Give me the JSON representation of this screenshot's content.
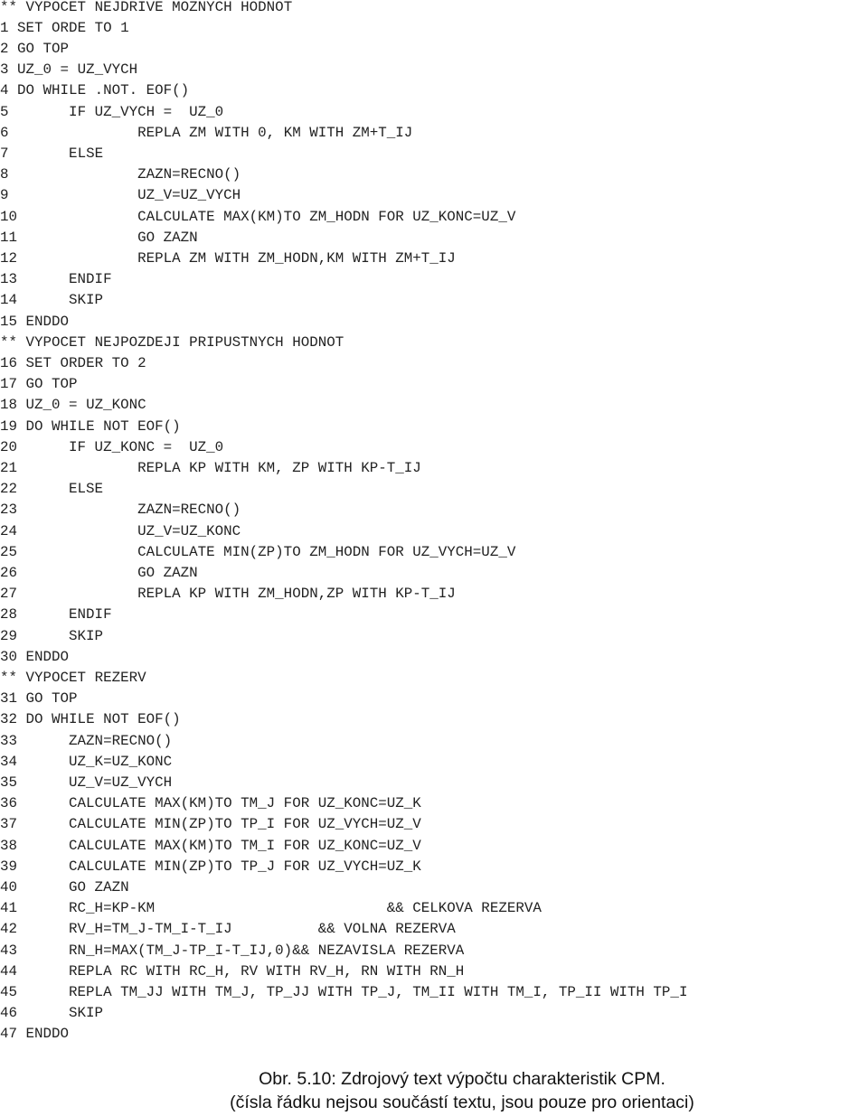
{
  "document": {
    "code_lines": [
      {
        "num": "**",
        "indent": 1,
        "text": "VYPOCET NEJDRIVE MOZNYCH HODNOT"
      },
      {
        "num": "1",
        "indent": 1,
        "text": "SET ORDE TO 1"
      },
      {
        "num": "2",
        "indent": 1,
        "text": "GO TOP"
      },
      {
        "num": "3",
        "indent": 1,
        "text": "UZ_0 = UZ_VYCH"
      },
      {
        "num": "4",
        "indent": 1,
        "text": "DO WHILE .NOT. EOF()"
      },
      {
        "num": "5",
        "indent": 7,
        "text": "IF UZ_VYCH =  UZ_0"
      },
      {
        "num": "6",
        "indent": 15,
        "text": "REPLA ZM WITH 0, KM WITH ZM+T_IJ"
      },
      {
        "num": "7",
        "indent": 7,
        "text": "ELSE"
      },
      {
        "num": "8",
        "indent": 15,
        "text": "ZAZN=RECNO()"
      },
      {
        "num": "9",
        "indent": 15,
        "text": "UZ_V=UZ_VYCH"
      },
      {
        "num": "10",
        "indent": 14,
        "text": "CALCULATE MAX(KM)TO ZM_HODN FOR UZ_KONC=UZ_V"
      },
      {
        "num": "11",
        "indent": 14,
        "text": "GO ZAZN"
      },
      {
        "num": "12",
        "indent": 14,
        "text": "REPLA ZM WITH ZM_HODN,KM WITH ZM+T_IJ"
      },
      {
        "num": "13",
        "indent": 6,
        "text": "ENDIF"
      },
      {
        "num": "14",
        "indent": 6,
        "text": "SKIP"
      },
      {
        "num": "15",
        "indent": 1,
        "text": "ENDDO"
      },
      {
        "num": "**",
        "indent": 1,
        "text": "VYPOCET NEJPOZDEJI PRIPUSTNYCH HODNOT"
      },
      {
        "num": "16",
        "indent": 1,
        "text": "SET ORDER TO 2"
      },
      {
        "num": "17",
        "indent": 1,
        "text": "GO TOP"
      },
      {
        "num": "18",
        "indent": 1,
        "text": "UZ_0 = UZ_KONC"
      },
      {
        "num": "19",
        "indent": 1,
        "text": "DO WHILE NOT EOF()"
      },
      {
        "num": "20",
        "indent": 6,
        "text": "IF UZ_KONC =  UZ_0"
      },
      {
        "num": "21",
        "indent": 14,
        "text": "REPLA KP WITH KM, ZP WITH KP-T_IJ"
      },
      {
        "num": "22",
        "indent": 6,
        "text": "ELSE"
      },
      {
        "num": "23",
        "indent": 14,
        "text": "ZAZN=RECNO()"
      },
      {
        "num": "24",
        "indent": 14,
        "text": "UZ_V=UZ_KONC"
      },
      {
        "num": "25",
        "indent": 14,
        "text": "CALCULATE MIN(ZP)TO ZM_HODN FOR UZ_VYCH=UZ_V"
      },
      {
        "num": "26",
        "indent": 14,
        "text": "GO ZAZN"
      },
      {
        "num": "27",
        "indent": 14,
        "text": "REPLA KP WITH ZM_HODN,ZP WITH KP-T_IJ"
      },
      {
        "num": "28",
        "indent": 6,
        "text": "ENDIF"
      },
      {
        "num": "29",
        "indent": 6,
        "text": "SKIP"
      },
      {
        "num": "30",
        "indent": 1,
        "text": "ENDDO"
      },
      {
        "num": "**",
        "indent": 1,
        "text": "VYPOCET REZERV"
      },
      {
        "num": "31",
        "indent": 1,
        "text": "GO TOP"
      },
      {
        "num": "32",
        "indent": 1,
        "text": "DO WHILE NOT EOF()"
      },
      {
        "num": "33",
        "indent": 6,
        "text": "ZAZN=RECNO()"
      },
      {
        "num": "34",
        "indent": 6,
        "text": "UZ_K=UZ_KONC"
      },
      {
        "num": "35",
        "indent": 6,
        "text": "UZ_V=UZ_VYCH"
      },
      {
        "num": "36",
        "indent": 6,
        "text": "CALCULATE MAX(KM)TO TM_J FOR UZ_KONC=UZ_K"
      },
      {
        "num": "37",
        "indent": 6,
        "text": "CALCULATE MIN(ZP)TO TP_I FOR UZ_VYCH=UZ_V"
      },
      {
        "num": "38",
        "indent": 6,
        "text": "CALCULATE MAX(KM)TO TM_I FOR UZ_KONC=UZ_V"
      },
      {
        "num": "39",
        "indent": 6,
        "text": "CALCULATE MIN(ZP)TO TP_J FOR UZ_VYCH=UZ_K"
      },
      {
        "num": "40",
        "indent": 6,
        "text": "GO ZAZN"
      },
      {
        "num": "41",
        "indent": 6,
        "text": "RC_H=KP-KM                           && CELKOVA REZERVA"
      },
      {
        "num": "42",
        "indent": 6,
        "text": "RV_H=TM_J-TM_I-T_IJ          && VOLNA REZERVA"
      },
      {
        "num": "43",
        "indent": 6,
        "text": "RN_H=MAX(TM_J-TP_I-T_IJ,0)&& NEZAVISLA REZERVA"
      },
      {
        "num": "44",
        "indent": 6,
        "text": "REPLA RC WITH RC_H, RV WITH RV_H, RN WITH RN_H"
      },
      {
        "num": "45",
        "indent": 6,
        "text": "REPLA TM_JJ WITH TM_J, TP_JJ WITH TP_J, TM_II WITH TM_I, TP_II WITH TP_I"
      },
      {
        "num": "46",
        "indent": 6,
        "text": "SKIP"
      },
      {
        "num": "47",
        "indent": 1,
        "text": "ENDDO"
      }
    ],
    "caption": {
      "line1": "Obr. 5.10: Zdrojový text výpočtu charakteristik CPM.",
      "line2": "(čísla řádku nejsou součástí textu, jsou pouze pro orientaci)"
    }
  }
}
